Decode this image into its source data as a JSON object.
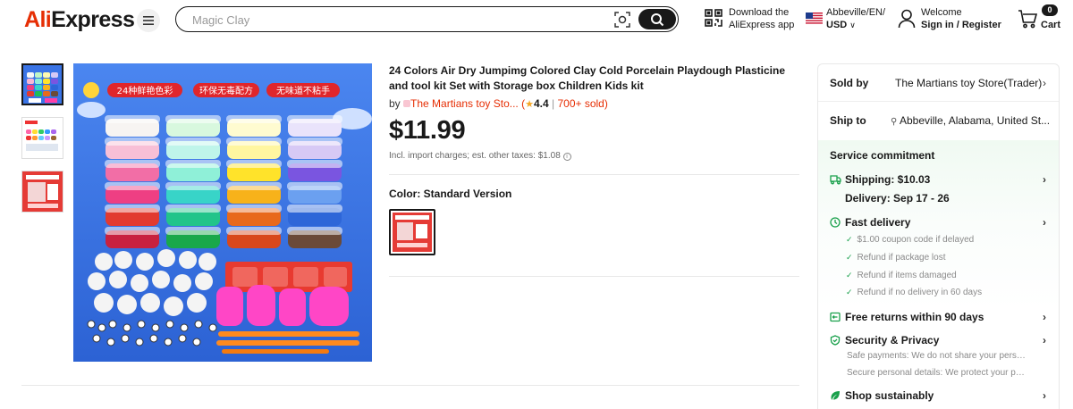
{
  "header": {
    "logo_prefix": "Ali",
    "logo_suffix": "Express",
    "menu_icon": "hamburger-menu-icon",
    "search": {
      "placeholder": "Magic Clay",
      "value": ""
    },
    "app": {
      "line1": "Download the",
      "line2": "AliExpress app"
    },
    "region": {
      "line1": "Abbeville/EN/",
      "line2": "USD"
    },
    "account": {
      "line1": "Welcome",
      "line2": "Sign in / Register"
    },
    "cart": {
      "count": "0",
      "label": "Cart"
    }
  },
  "gallery": {
    "thumbnails": [
      "thumbnail-1",
      "thumbnail-2",
      "thumbnail-3"
    ],
    "active_index": 0,
    "image_labels": [
      "24种鲜艳色彩",
      "环保无毒配方",
      "无味道不粘手"
    ]
  },
  "product": {
    "title": "24 Colors Air Dry Jumpimg Colored Clay Cold Porcelain Playdough Plasticine and tool kit Set with Storage box Children Kids kit",
    "by_label": "by",
    "store_name": "The Martians toy Sto...",
    "rating": "4.4",
    "sold": "700+ sold",
    "price": "$11.99",
    "tax_note": "Incl. import charges; est. other taxes: $1.08",
    "color_label": "Color: Standard Version"
  },
  "panel": {
    "sold_by_label": "Sold by",
    "sold_by_value": "The Martians toy Store(Trader)",
    "ship_to_label": "Ship to",
    "ship_to_value": "Abbeville, Alabama, United St...",
    "service_title": "Service commitment",
    "shipping": "Shipping: $10.03",
    "delivery": "Delivery: Sep 17 - 26",
    "fast_delivery": "Fast delivery",
    "fast_items": [
      "$1.00 coupon code if delayed",
      "Refund if package lost",
      "Refund if items damaged",
      "Refund if no delivery in 60 days"
    ],
    "free_returns": "Free returns within 90 days",
    "security": "Security & Privacy",
    "security_items": [
      "Safe payments: We do not share your perso...",
      "Secure personal details: We protect your pri..."
    ],
    "sustainably": "Shop sustainably"
  },
  "colors": {
    "brand": "#e62e04",
    "green": "#19a04b",
    "text": "#191919"
  }
}
